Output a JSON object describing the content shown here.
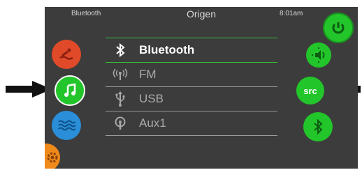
{
  "status_bar": {
    "source": "Bluetooth",
    "title": "Origen",
    "time": "8:01am"
  },
  "source_list": [
    {
      "label": "Bluetooth",
      "icon": "bluetooth-icon",
      "active": true
    },
    {
      "label": "FM",
      "icon": "radio-signal-icon",
      "active": false
    },
    {
      "label": "USB",
      "icon": "usb-icon",
      "active": false
    },
    {
      "label": "Aux1",
      "icon": "aux-input-icon",
      "active": false
    }
  ],
  "right_buttons": {
    "src_label": "src"
  },
  "colors": {
    "screen": "#3c3c3c",
    "accent_green": "#22c52a",
    "orange": "#f08a1a",
    "red": "#e04a28",
    "blue": "#2a8ed8"
  }
}
